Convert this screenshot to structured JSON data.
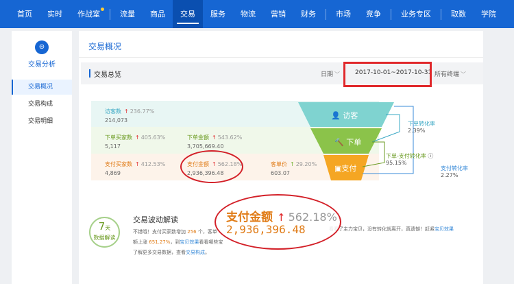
{
  "topnav": {
    "items": [
      "首页",
      "实时",
      "作战室",
      "流量",
      "商品",
      "交易",
      "服务",
      "物流",
      "营销",
      "财务",
      "市场",
      "竞争",
      "业务专区",
      "取数",
      "学院"
    ],
    "active_index": 5
  },
  "sidebar": {
    "title": "交易分析",
    "items": [
      "交易概况",
      "交易构成",
      "交易明细"
    ],
    "active_index": 0
  },
  "main": {
    "page_title": "交易概况",
    "section_title": "交易总览",
    "date_label": "日期",
    "date_range": "2017-10-01~2017-10-31",
    "terminal_label": "所有终端"
  },
  "metrics": {
    "visitors": {
      "name": "访客数",
      "pct": "236.77%",
      "value": "214,073"
    },
    "order_buyers": {
      "name": "下单买家数",
      "pct": "405.63%",
      "value": "5,117"
    },
    "order_amount": {
      "name": "下单金额",
      "pct": "543.62%",
      "value": "3,705,669.40"
    },
    "pay_buyers": {
      "name": "支付买家数",
      "pct": "412.53%",
      "value": "4,869"
    },
    "pay_amount": {
      "name": "支付金额",
      "pct": "562.18%",
      "value": "2,936,396.48"
    },
    "unit_price": {
      "name": "客单价",
      "pct": "29.20%",
      "value": "603.07"
    }
  },
  "funnel": {
    "stage_visit": "访客",
    "stage_order": "下单",
    "stage_pay": "支付"
  },
  "conversions": {
    "order_rate": {
      "label": "下单转化率",
      "value": "2.39%"
    },
    "order_pay_rate": {
      "label": "下单-支付转化率",
      "value": "95.15%"
    },
    "pay_rate": {
      "label": "支付转化率",
      "value": "2.27%"
    }
  },
  "zoom": {
    "name": "支付金额",
    "pct": "562.18%",
    "value": "2,936,396.48"
  },
  "analysis": {
    "badge_num": "7",
    "badge_unit": "天",
    "badge_text": "数据解读",
    "title": "交易波动解读",
    "line1_a": "不错哦！支付买家数增加",
    "line1_num": "256",
    "line1_b": "个，客单",
    "line1_tail_a": "看看了主力宝贝，没有转化就离开，真遗憾！赶紧",
    "line1_tail_link": "宝贝效果",
    "line2_a": "额上涨",
    "line2_num": "651.27%",
    "line2_b": "，到",
    "line2_link": "宝贝效果",
    "line2_c": "看看哪些宝",
    "line3_a": "了解更多交易数据，查看",
    "line3_link": "交易构成",
    "line3_b": "。"
  },
  "colors": {
    "nav": "#1666d3",
    "visit": "#7fd3d0",
    "order": "#8bc34a",
    "pay": "#f5a623",
    "highlight": "#e0282b"
  }
}
